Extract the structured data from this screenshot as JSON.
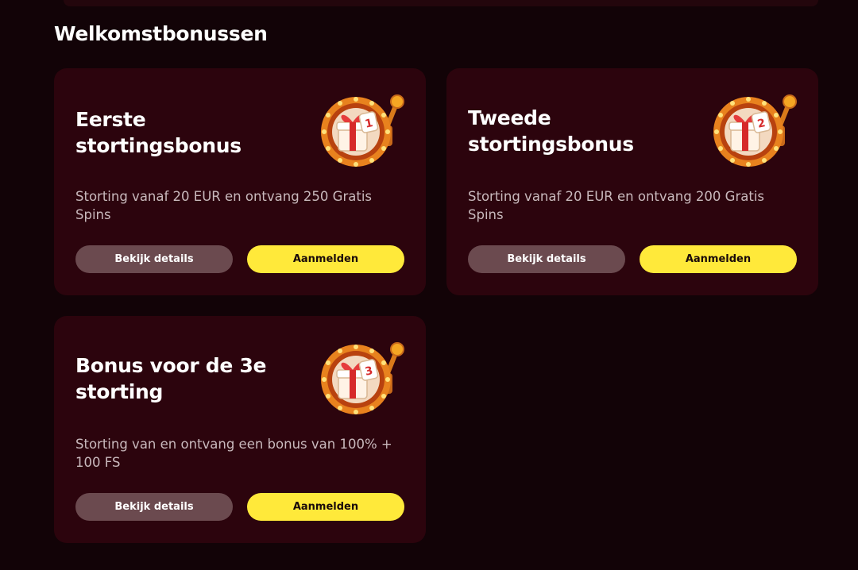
{
  "section": {
    "title": "Welkomstbonussen"
  },
  "cards": [
    {
      "title": "Eerste stortingsbonus",
      "description": "Storting vanaf 20 EUR en ontvang 250 Gratis Spins",
      "icon_number": "1",
      "details_label": "Bekijk details",
      "signup_label": "Aanmelden"
    },
    {
      "title": "Tweede stortingsbonus",
      "description": "Storting vanaf 20 EUR en ontvang 200 Gratis Spins",
      "icon_number": "2",
      "details_label": "Bekijk details",
      "signup_label": "Aanmelden"
    },
    {
      "title": "Bonus voor de 3e storting",
      "description": "Storting van en ontvang een bonus van 100% + 100 FS",
      "icon_number": "3",
      "details_label": "Bekijk details",
      "signup_label": "Aanmelden"
    }
  ],
  "colors": {
    "background": "#120307",
    "card": "#2c040d",
    "details_button": "#6b4a4f",
    "signup_button": "#ffe93a"
  },
  "icons": [
    "slot-machine-gift-icon"
  ]
}
